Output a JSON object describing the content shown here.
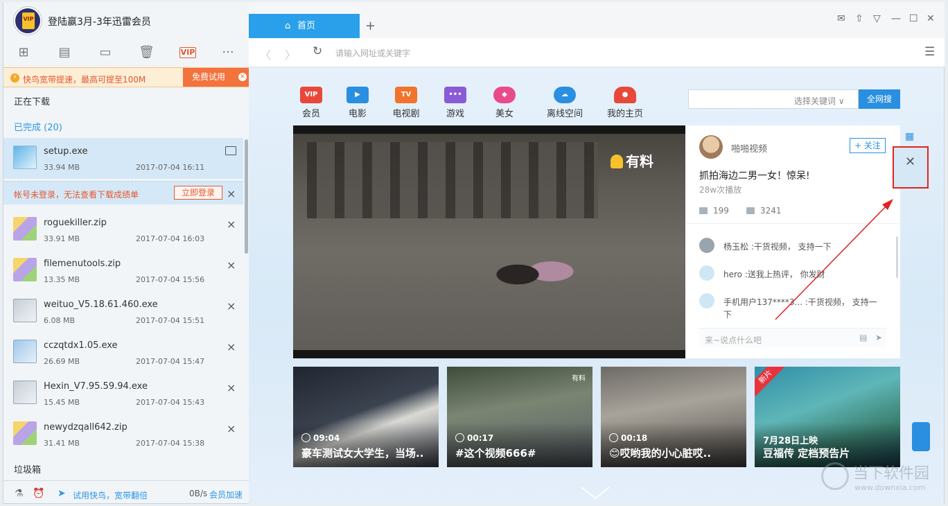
{
  "app": {
    "username": "登陆赢3月-3年迅雷会员",
    "avatar_badge": "VIP"
  },
  "banner": {
    "text": "快鸟宽带提速，最高可提至100M",
    "button": "免费试用",
    "close": "×"
  },
  "sections": {
    "downloading": "正在下载",
    "completed": "已完成 (20)",
    "trash": "垃圾箱"
  },
  "login_notice": {
    "text": "帐号未登录，无法查看下载成绩单",
    "button": "立即登录",
    "close": "×"
  },
  "files": [
    {
      "name": "setup.exe",
      "size": "33.94 MB",
      "date": "2017-07-04 16:11",
      "icon": "setup-installer-icon"
    },
    {
      "name": "roguekiller.zip",
      "size": "33.91 MB",
      "date": "2017-07-04 16:03",
      "icon": "zip-icon"
    },
    {
      "name": "filemenutools.zip",
      "size": "13.35 MB",
      "date": "2017-07-04 15:56",
      "icon": "zip-icon"
    },
    {
      "name": "weituo_V5.18.61.460.exe",
      "size": "6.08 MB",
      "date": "2017-07-04 15:51",
      "icon": "exe-icon"
    },
    {
      "name": "cczqtdx1.05.exe",
      "size": "26.69 MB",
      "date": "2017-07-04 15:47",
      "icon": "exe-icon"
    },
    {
      "name": "Hexin_V7.95.59.94.exe",
      "size": "15.45 MB",
      "date": "2017-07-04 15:43",
      "icon": "exe-icon"
    },
    {
      "name": "newydzqall642.zip",
      "size": "31.41 MB",
      "date": "2017-07-04 15:38",
      "icon": "zip-icon"
    }
  ],
  "bottombar": {
    "try_text": "试用快鸟，宽带翻倍",
    "speed": "0B/s",
    "speed_link": "会员加速"
  },
  "browser": {
    "tab_home": "首页",
    "tab_add": "+",
    "address_placeholder": "请输入网址或关键字"
  },
  "categories": [
    {
      "label": "会员",
      "badge": "VIP",
      "color": "#e8483b"
    },
    {
      "label": "电影",
      "badge": "▶",
      "color": "#2a8fe0"
    },
    {
      "label": "电视剧",
      "badge": "TV",
      "color": "#f0742b"
    },
    {
      "label": "游戏",
      "badge": "•••",
      "color": "#8a5bd6"
    },
    {
      "label": "美女",
      "badge": "◆",
      "color": "#e84a8a"
    },
    {
      "label": "离线空间",
      "badge": "☁",
      "color": "#2a8fe0"
    },
    {
      "label": "我的主页",
      "badge": "●",
      "color": "#e8483b"
    }
  ],
  "search": {
    "select": "选择关键词 ∨",
    "button": "全网搜"
  },
  "video": {
    "brand": "有料"
  },
  "side": {
    "author": "啪啪视频",
    "follow": "+ 关注",
    "title": "抓拍海边二男一女！惊呆!",
    "plays": "28w次播放",
    "comments_count": "199",
    "likes": "3241",
    "comments": [
      {
        "text": "杨玉松 :干货视频， 支持一下"
      },
      {
        "text": "hero :送我上热评， 你发财"
      },
      {
        "text": "手机用户137****3... :干货视频， 支持一下"
      }
    ],
    "comment_placeholder": "来~说点什么吧"
  },
  "thumbs": [
    {
      "duration": "09:04",
      "title": "豪车测试女大学生，当场..",
      "badge": ""
    },
    {
      "duration": "00:17",
      "title": "#这个视频666#",
      "badge": "有料"
    },
    {
      "duration": "00:18",
      "title": "😊哎哟我的小心脏哎..",
      "badge": ""
    },
    {
      "duration": "",
      "title": "豆福传 定档预告片",
      "badge": "",
      "date_line": "7月28日上映",
      "tag": "新片"
    }
  ],
  "watermark": {
    "title": "当下软件园",
    "url": "www.downxia.com"
  }
}
